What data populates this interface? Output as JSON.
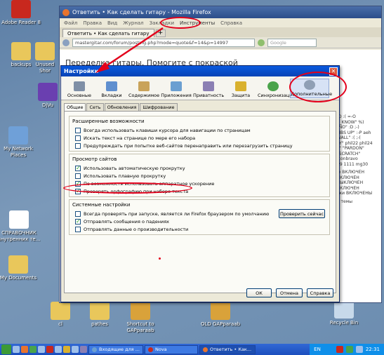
{
  "desktop": {
    "icons": [
      {
        "label": "Adobe Reader 8"
      },
      {
        "label": "backups"
      },
      {
        "label": "Unused",
        "label2": "Shor"
      },
      {
        "label": "DjVu"
      },
      {
        "label": "My Network",
        "label2": "Places"
      },
      {
        "label": "СПРАВОЧНИК",
        "label2": "внутренних те..."
      },
      {
        "label": "My Documents"
      },
      {
        "label": "cl"
      },
      {
        "label": "pathes"
      },
      {
        "label": "Shortcut to",
        "label2": "GAPparaab"
      },
      {
        "label": "OLD GAPparaab"
      },
      {
        "label": "Recycle Bin"
      }
    ]
  },
  "browser": {
    "window_title": "Ответить • Как сделать гитару - Mozilla Firefox",
    "menu": [
      "Файл",
      "Правка",
      "Вид",
      "Журнал",
      "Закладки",
      "Инструменты",
      "Справка"
    ],
    "tab_label": "Ответить • Как сделать гитару",
    "new_tab": "+",
    "url": "mastergitar.com/forum/posting.php?mode=quote&f=14&p=14997",
    "search_placeholder": "Google",
    "page_heading": "Переделка гитары. Помогите с покраской",
    "side_lines": [
      ":D  :(  =-O",
      "T_KNOW\"  %)",
      "\"NO\"  :D  ;-)",
      "MBS UP\"  :-P  aeh",
      "WALL\"  :(  ;-(",
      "?Y\"  phil22  phil24",
      "?\"  \"PARDON\"",
      "\"SCRATCH\"",
      "iconbravo",
      "89  1111  mg30",
      "le ВКЛЮЧЁН",
      "ВКЛЮЧЁН",
      "ВЫКЛЮЧЕН",
      "ВКЛЮЧЁН",
      "ьки ВКЛЮЧЕНЫ",
      "я темы"
    ]
  },
  "settings": {
    "title": "Настройки",
    "close_label": "✕",
    "panes": [
      {
        "label": "Основные",
        "color": "#7f8fa6"
      },
      {
        "label": "Вкладки",
        "color": "#5f8fcf"
      },
      {
        "label": "Содержимое",
        "color": "#c9a35a"
      },
      {
        "label": "Приложения",
        "color": "#6b9fd1"
      },
      {
        "label": "Приватность",
        "color": "#8b7fb3"
      },
      {
        "label": "Защита",
        "color": "#d9b12e"
      },
      {
        "label": "Синхронизация",
        "color": "#4aa34a"
      },
      {
        "label": "Дополнительные",
        "color": "#8f9fb5"
      }
    ],
    "subtabs": [
      "Общие",
      "Сеть",
      "Обновления",
      "Шифрование"
    ],
    "groups": [
      {
        "title": "Расширенные возможности",
        "items": [
          {
            "label": "Всегда использовать клавиши курсора для навигации по страницам",
            "checked": false
          },
          {
            "label": "Искать текст на странице по мере его набора",
            "checked": false
          },
          {
            "label": "Предупреждать при попытке веб-сайтов перенаправить или перезагрузить страницу",
            "checked": false
          }
        ]
      },
      {
        "title": "Просмотр сайтов",
        "items": [
          {
            "label": "Использовать автоматическую прокрутку",
            "checked": true
          },
          {
            "label": "Использовать плавную прокрутку",
            "checked": false
          },
          {
            "label": "По возможности использовать аппаратное ускорение",
            "checked": true
          },
          {
            "label": "Проверять орфографию при наборе текста",
            "checked": true
          }
        ]
      },
      {
        "title": "Системные настройки",
        "items": [
          {
            "label": "Всегда проверять при запуске, является ли Firefox браузером по умолчанию",
            "checked": false
          },
          {
            "label": "Отправлять сообщения о падениях",
            "checked": true
          },
          {
            "label": "Отправлять данные о производительности",
            "checked": false
          }
        ],
        "button": "Проверить сейчас"
      }
    ],
    "buttons": {
      "ok": "ОК",
      "cancel": "Отмена",
      "help": "Справка"
    }
  },
  "taskbar": {
    "tasks": [
      {
        "label": "Входящие для ..."
      },
      {
        "label": "Nova"
      },
      {
        "label": "Ответить • Как..."
      }
    ],
    "language": "EN",
    "clock": "22:31"
  },
  "colors": {
    "annotation": "#e3001b",
    "title_bar": "#0a5adf",
    "taskbar": "#1c4fbe"
  }
}
